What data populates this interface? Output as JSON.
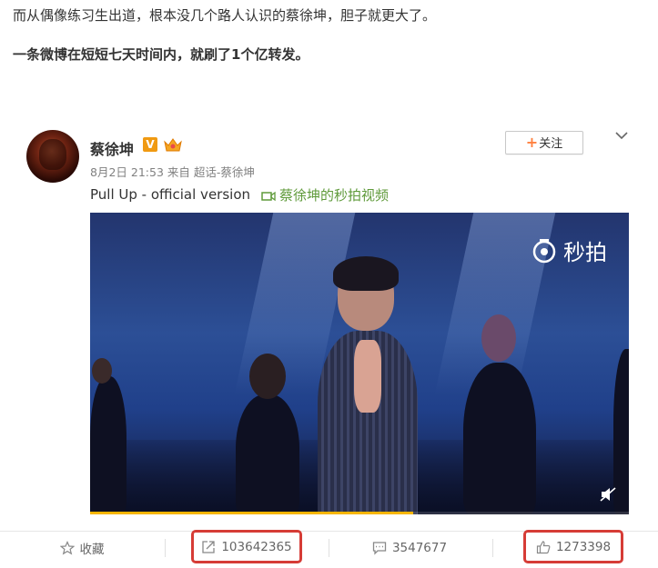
{
  "article": {
    "line1": "而从偶像练习生出道，根本没几个路人认识的蔡徐坤，胆子就更大了。",
    "line2": "一条微博在短短七天时间内，就刷了1个亿转发。"
  },
  "post": {
    "username": "蔡徐坤",
    "badge_label": "V",
    "meta": "8月2日 21:53 来自 超话-蔡徐坤",
    "text": "Pull Up - official version",
    "video_link": "蔡徐坤的秒拍视频",
    "follow": {
      "plus": "+",
      "label": "关注"
    },
    "video": {
      "watermark": "秒拍",
      "progress_fraction": 0.6
    },
    "actions": {
      "favorite": "收藏",
      "reposts": "103642365",
      "comments": "3547677",
      "likes": "1273398"
    },
    "highlight_color": "#d63c36",
    "accent_orange": "#ff8140",
    "link_green": "#5f9a3a"
  }
}
